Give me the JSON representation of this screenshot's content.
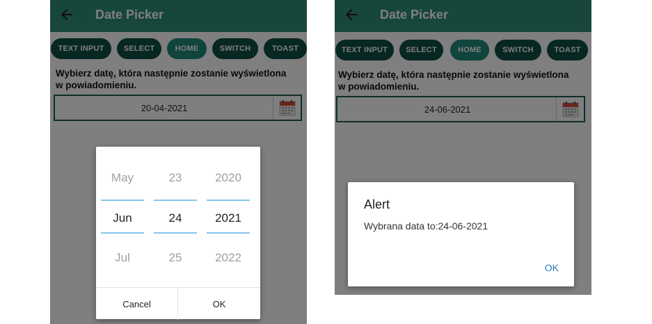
{
  "screens": {
    "left": {
      "app_bar": {
        "title": "Date Picker",
        "back_icon": "arrow-left-icon"
      },
      "tabs": [
        {
          "label": "TEXT INPUT",
          "active": false
        },
        {
          "label": "SELECT",
          "active": false
        },
        {
          "label": "HOME",
          "active": true
        },
        {
          "label": "SWITCH",
          "active": false
        },
        {
          "label": "TOAST",
          "active": false
        }
      ],
      "description": "Wybierz datę, która następnie zostanie wyświetlona w powiadomieniu.",
      "date_input": {
        "value": "20-04-2021",
        "calendar_icon": "calendar-icon"
      },
      "date_picker": {
        "month": {
          "prev": "May",
          "selected": "Jun",
          "next": "Jul"
        },
        "day": {
          "prev": "23",
          "selected": "24",
          "next": "25"
        },
        "year": {
          "prev": "2020",
          "selected": "2021",
          "next": "2022"
        },
        "cancel_label": "Cancel",
        "ok_label": "OK"
      }
    },
    "right": {
      "app_bar": {
        "title": "Date Picker",
        "back_icon": "arrow-left-icon"
      },
      "tabs": [
        {
          "label": "TEXT INPUT",
          "active": false
        },
        {
          "label": "SELECT",
          "active": false
        },
        {
          "label": "HOME",
          "active": true
        },
        {
          "label": "SWITCH",
          "active": false
        },
        {
          "label": "TOAST",
          "active": false
        }
      ],
      "description": "Wybierz datę, która następnie zostanie wyświetlona w powiadomieniu.",
      "date_input": {
        "value": "24-06-2021",
        "calendar_icon": "calendar-icon"
      },
      "alert": {
        "title": "Alert",
        "message": "Wybrana data to:24-06-2021",
        "ok_label": "OK"
      }
    }
  },
  "colors": {
    "app_bar": "#2e8d78",
    "chip": "#0e4f45",
    "chip_active": "#1f8a78",
    "picker_divider": "#86c5ea",
    "alert_button": "#2a7cc0"
  }
}
